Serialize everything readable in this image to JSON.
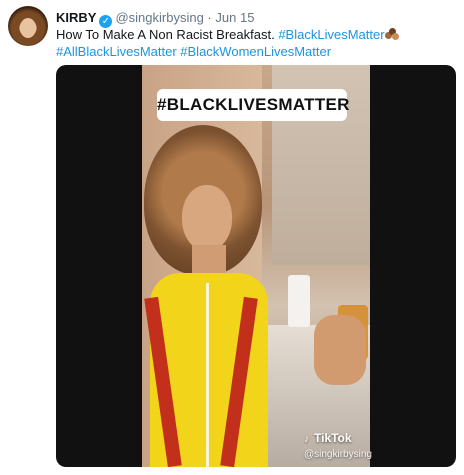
{
  "tweet": {
    "author_name": "KIRBY",
    "handle": "@singkirbysing",
    "separator": "·",
    "date": "Jun 15",
    "text_plain": "How To Make A Non Racist Breakfast.",
    "hashtags": [
      "#BlackLivesMatter",
      "#AllBlackLivesMatter",
      "#BlackWomenLivesMatter"
    ],
    "emoji": "three-circles-emoji"
  },
  "media": {
    "overlay_caption": "#BLACKLIVESMATTER",
    "watermark": {
      "brand": "TikTok",
      "user": "@singkirbysing",
      "icon": "tiktok-note-icon"
    }
  },
  "colors": {
    "hashtag": "#1b95e0",
    "verified": "#1da1f2",
    "meta": "#657786",
    "text": "#14171a"
  }
}
